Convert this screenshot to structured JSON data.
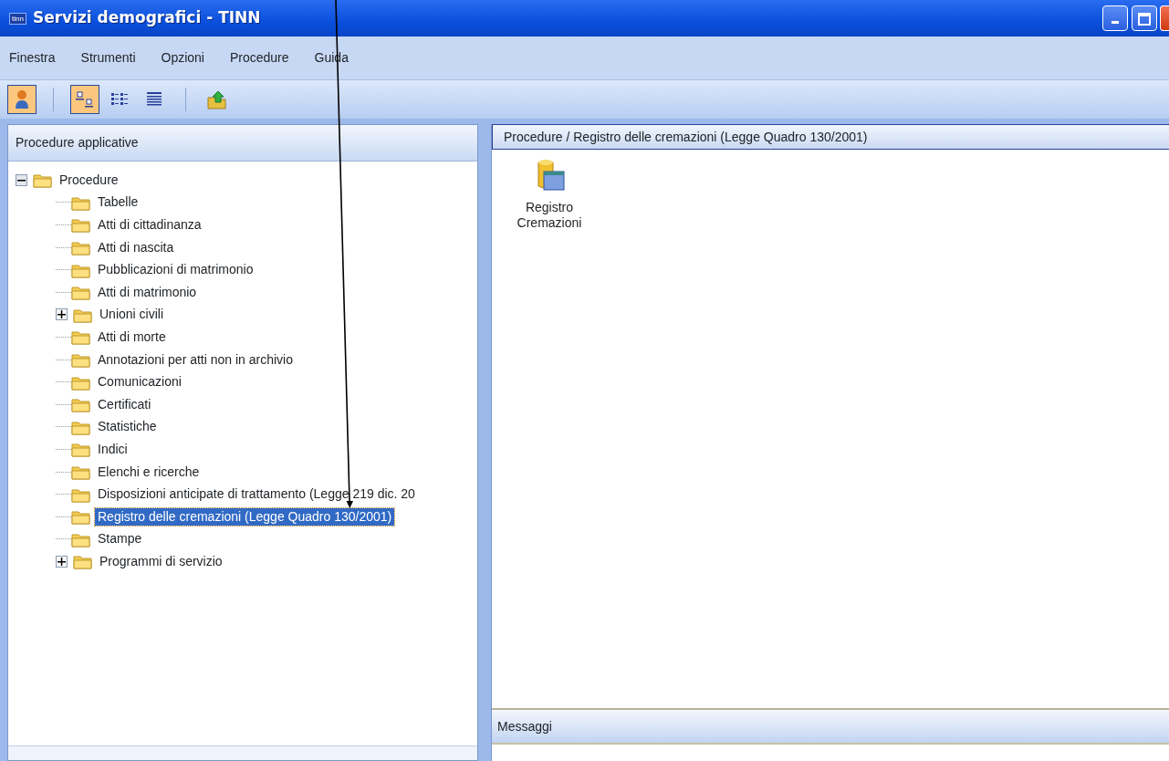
{
  "window": {
    "title": "Servizi demografici - TINN",
    "app_badge": "tinn"
  },
  "menu": [
    "Finestra",
    "Strumenti",
    "Opzioni",
    "Procedure",
    "Guida"
  ],
  "toolbar": [
    {
      "kind": "user",
      "selected": true
    },
    {
      "kind": "separator"
    },
    {
      "kind": "large-icons",
      "selected": true
    },
    {
      "kind": "small-icons",
      "selected": false
    },
    {
      "kind": "details",
      "selected": false
    },
    {
      "kind": "separator"
    },
    {
      "kind": "up-folder",
      "selected": false
    }
  ],
  "left_panel": {
    "title": "Procedure applicative",
    "tree": [
      {
        "kind": "group",
        "label": "Procedure",
        "expanded": true,
        "selected": false,
        "children": [
          {
            "kind": "leaf",
            "label": "Tabelle",
            "selected": false
          },
          {
            "kind": "leaf",
            "label": "Atti di cittadinanza",
            "selected": false
          },
          {
            "kind": "leaf",
            "label": "Atti di nascita",
            "selected": false
          },
          {
            "kind": "leaf",
            "label": "Pubblicazioni di matrimonio",
            "selected": false
          },
          {
            "kind": "leaf",
            "label": "Atti di matrimonio",
            "selected": false
          },
          {
            "kind": "group",
            "label": "Unioni civili",
            "expanded": false,
            "selected": false
          },
          {
            "kind": "leaf",
            "label": "Atti di morte",
            "selected": false
          },
          {
            "kind": "leaf",
            "label": "Annotazioni per atti non in archivio",
            "selected": false
          },
          {
            "kind": "leaf",
            "label": "Comunicazioni",
            "selected": false
          },
          {
            "kind": "leaf",
            "label": "Certificati",
            "selected": false
          },
          {
            "kind": "leaf",
            "label": "Statistiche",
            "selected": false
          },
          {
            "kind": "leaf",
            "label": "Indici",
            "selected": false
          },
          {
            "kind": "leaf",
            "label": "Elenchi e ricerche",
            "selected": false
          },
          {
            "kind": "leaf",
            "label": "Disposizioni anticipate di trattamento (Legge 219 dic. 20",
            "selected": false
          },
          {
            "kind": "leaf",
            "label": "Registro delle cremazioni (Legge Quadro 130/2001)",
            "selected": true
          },
          {
            "kind": "leaf",
            "label": "Stampe",
            "selected": false
          },
          {
            "kind": "group",
            "label": "Programmi di servizio",
            "expanded": false,
            "selected": false
          }
        ]
      }
    ]
  },
  "right_panel": {
    "path": "Procedure / Registro delle cremazioni (Legge Quadro 130/2001)",
    "items": [
      {
        "label": "Registro Cremazioni"
      }
    ],
    "messages_title": "Messaggi"
  }
}
